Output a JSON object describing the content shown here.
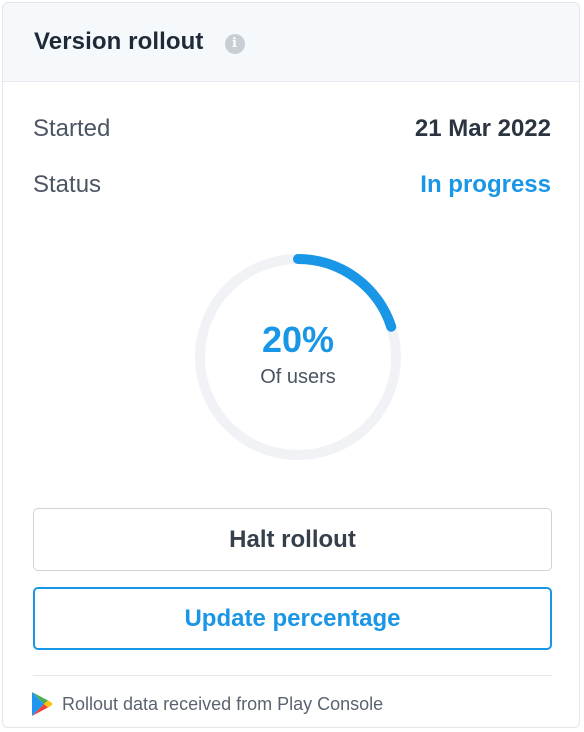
{
  "header": {
    "title": "Version rollout",
    "info_icon": "info-icon"
  },
  "details": {
    "started_label": "Started",
    "started_value": "21 Mar 2022",
    "status_label": "Status",
    "status_value": "In progress"
  },
  "progress": {
    "percent_text": "20%",
    "fraction": 0.2,
    "caption": "Of users"
  },
  "actions": {
    "halt_label": "Halt rollout",
    "update_label": "Update percentage"
  },
  "footer": {
    "icon": "google-play-icon",
    "text": "Rollout data received from Play Console"
  },
  "colors": {
    "accent": "#1a96e6",
    "ring_track": "#f0f2f5",
    "header_bg": "#f6f9fc"
  }
}
